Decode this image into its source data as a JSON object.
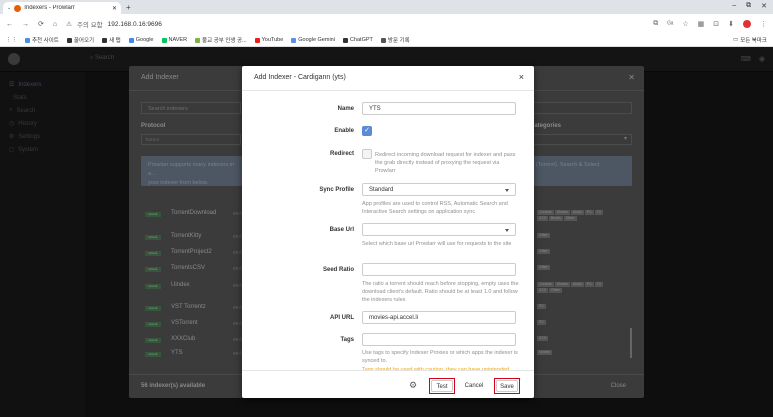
{
  "browser": {
    "tab_title": "Indexers - Prowlarr",
    "new_tab": "+",
    "window_controls": [
      "–",
      "⧉",
      "✕"
    ],
    "nav": [
      "←",
      "→",
      "⟳",
      "⌂"
    ],
    "security_label": "주의 요함",
    "url": "192.168.0.16:9696",
    "right_icons": [
      "⧉",
      "ᴳᵃ",
      "☆",
      "▦",
      "⊡",
      "⬇",
      "⋮"
    ],
    "bookmarks": [
      {
        "label": "추천 사이트",
        "color": "#4a90e2"
      },
      {
        "label": "꿀어오기",
        "color": "#333333"
      },
      {
        "label": "새 탭",
        "color": "#333333"
      },
      {
        "label": "Google",
        "color": "#4285f4"
      },
      {
        "label": "NAVER",
        "color": "#03c75a"
      },
      {
        "label": "불교 공부 인생 공...",
        "color": "#7cb342"
      },
      {
        "label": "YouTube",
        "color": "#e62117"
      },
      {
        "label": "Google Gemini",
        "color": "#5b8def"
      },
      {
        "label": "ChatGPT",
        "color": "#333333"
      },
      {
        "label": "방문 기록",
        "color": "#555555"
      }
    ],
    "all_bookmarks": "모든 북마크"
  },
  "app": {
    "search_placeholder": "Search",
    "sidebar": [
      {
        "icon": "☰",
        "label": "Indexers",
        "active": true
      },
      {
        "icon": "",
        "label": "Stats",
        "active": false
      },
      {
        "icon": "⌕",
        "label": "Search",
        "active": false
      },
      {
        "icon": "◷",
        "label": "History",
        "active": false
      },
      {
        "icon": "⚙",
        "label": "Settings",
        "active": false
      },
      {
        "icon": "◻",
        "label": "System",
        "active": false
      }
    ]
  },
  "add_indexer_modal": {
    "title": "Add Indexer",
    "search_placeholder": "Search indexers",
    "protocol_label": "Protocol",
    "protocol_value": "Torrent",
    "categories_label": "Categories",
    "info_left": "Prowlarr supports many indexers in a…",
    "info_left2": "your indexer from below.",
    "info_right": "(Torrent). Search & Select",
    "indexers": [
      {
        "badge": "torrent",
        "name": "TorrentDownload",
        "lang": "en-US",
        "cats": [
          "Console",
          "Movies",
          "Audio",
          "PC",
          "TV",
          "XXX",
          "Books",
          "Other"
        ]
      },
      {
        "badge": "torrent",
        "name": "TorrentKitty",
        "lang": "en-US",
        "cats": [
          "Other"
        ]
      },
      {
        "badge": "torrent",
        "name": "TorrentProject2",
        "lang": "en-US",
        "cats": [
          "Other"
        ]
      },
      {
        "badge": "torrent",
        "name": "TorrentsCSV",
        "lang": "en-US",
        "cats": [
          "Other"
        ]
      },
      {
        "badge": "torrent",
        "name": "Uindex",
        "lang": "en-US",
        "cats": [
          "Console",
          "Movies",
          "Audio",
          "PC",
          "TV",
          "XXX",
          "Other"
        ]
      },
      {
        "badge": "torrent",
        "name": "VST Torrentz",
        "lang": "en-US",
        "cats": [
          "PC"
        ]
      },
      {
        "badge": "torrent",
        "name": "VSTorrent",
        "lang": "en-US",
        "cats": [
          "PC"
        ]
      },
      {
        "badge": "torrent",
        "name": "XXXClub",
        "lang": "en-US",
        "cats": [
          "XXX"
        ]
      },
      {
        "badge": "torrent",
        "name": "YTS",
        "lang": "en-US",
        "cats": [
          "Movies"
        ]
      }
    ],
    "count": "56 indexer(s) available",
    "close_label": "Close"
  },
  "cardigann_modal": {
    "title": "Add Indexer - Cardigann (yts)",
    "close_icon": "×",
    "name": {
      "label": "Name",
      "value": "YTS"
    },
    "enable": {
      "label": "Enable",
      "checked": true
    },
    "redirect": {
      "label": "Redirect",
      "help": "Redirect incoming download request for indexer and pass the grab directly instead of proxying the request via Prowlarr"
    },
    "sync_profile": {
      "label": "Sync Profile",
      "value": "Standard",
      "help": "App profiles are used to control RSS, Automatic Search and Interactive Search settings on application sync"
    },
    "base_url": {
      "label": "Base Url",
      "value": "",
      "help": "Select which base url Prowlarr will use for requests to the site"
    },
    "seed_ratio": {
      "label": "Seed Ratio",
      "value": "",
      "help": "The ratio a torrent should reach before stopping, empty uses the download client's default. Ratio should be at least 1.0 and follow the indexers rules"
    },
    "api_url": {
      "label": "API URL",
      "value": "movies-api.accel.li"
    },
    "tags": {
      "label": "Tags",
      "value": "",
      "help": "Use tags to specify Indexer Proxies or which apps the indexer is synced to.",
      "warning": "Tags should be used with caution, they can have unintended"
    },
    "footer": {
      "test": "Test",
      "cancel": "Cancel",
      "save": "Save"
    }
  },
  "colors": {
    "accent": "#5a8bd6",
    "highlight": "#d0021b",
    "warning": "#f0a500"
  }
}
